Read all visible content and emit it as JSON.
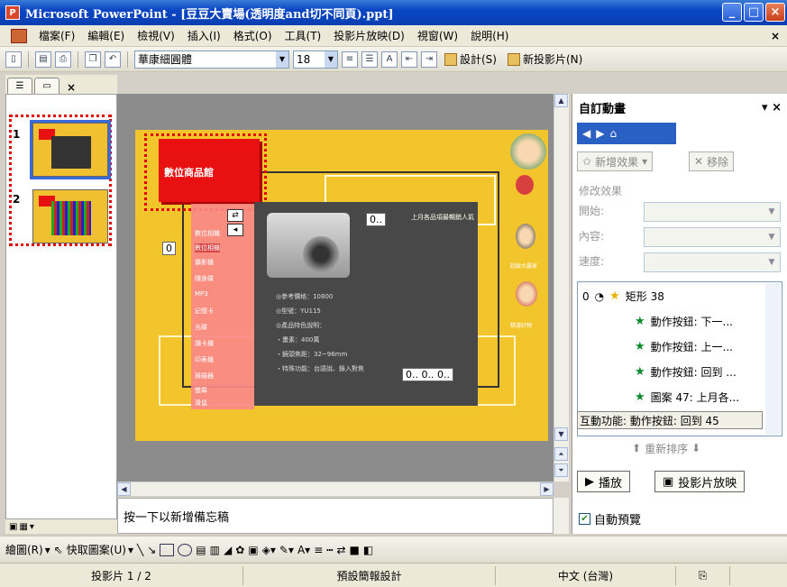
{
  "window": {
    "title": "Microsoft PowerPoint - [豆豆大賣場(透明度and切不同頁).ppt]",
    "app_icon": "powerpoint-icon"
  },
  "menubar": {
    "items": [
      "檔案(F)",
      "編輯(E)",
      "檢視(V)",
      "插入(I)",
      "格式(O)",
      "工具(T)",
      "投影片放映(D)",
      "視窗(W)",
      "說明(H)"
    ]
  },
  "toolbar": {
    "font_name": "華康細圓體",
    "font_size": "18",
    "design_label": "設計(S)",
    "new_slide_label": "新投影片(N)"
  },
  "slides_panel": {
    "slides": [
      {
        "number": "1",
        "selected": true
      },
      {
        "number": "2",
        "selected": false
      }
    ]
  },
  "slide": {
    "banner_text": "數位商品館",
    "top_label": "上月各品項最暢銷人氣",
    "menu_items": [
      "數位相機",
      "數位相機",
      "攝影機",
      "隨身碟",
      "MP3",
      "記憶卡",
      "光碟",
      "讀卡機",
      "印表機",
      "掃描器",
      "螢幕",
      "滑鼠"
    ],
    "specs": [
      "◎參考價格：10800",
      "◎型號：YU115",
      "◎產品特色說明：",
      "・畫素：400萬",
      "・鏡頭焦距：32~96mm",
      "・特殊功能：台語說、錄入對焦"
    ],
    "num_label_1": "0..",
    "num_label_2": "0",
    "num_label_3": "0.. 0.. 0..",
    "side_caption_1": "超級大贏家",
    "side_caption_2": "精選好物"
  },
  "notes": {
    "placeholder": "按一下以新增備忘稿"
  },
  "task_pane": {
    "title": "自訂動畫",
    "add_effect": "新增效果",
    "remove": "移除",
    "modify_label": "修改效果",
    "start_label": "開始:",
    "property_label": "內容:",
    "speed_label": "速度:",
    "animations": [
      {
        "index": "0",
        "label": "矩形 38",
        "icon": "star-yellow-icon"
      },
      {
        "index": "",
        "label": "動作按鈕: 下一...",
        "icon": "star-green-icon"
      },
      {
        "index": "",
        "label": "動作按鈕: 上一...",
        "icon": "star-green-icon"
      },
      {
        "index": "",
        "label": "動作按鈕: 回到 ...",
        "icon": "star-green-icon"
      },
      {
        "index": "",
        "label": "圖案 47: 上月各...",
        "icon": "star-green-icon"
      }
    ],
    "status": "互動功能: 動作按鈕: 回到 45",
    "reorder": "重新排序",
    "play": "播放",
    "slideshow": "投影片放映",
    "auto_preview": "自動預覽"
  },
  "drawbar": {
    "draw": "繪圖(R)",
    "autoshapes": "快取圖案(U)"
  },
  "statusbar": {
    "slide_info": "投影片 1 / 2",
    "design": "預設簡報設計",
    "language": "中文 (台灣)"
  }
}
